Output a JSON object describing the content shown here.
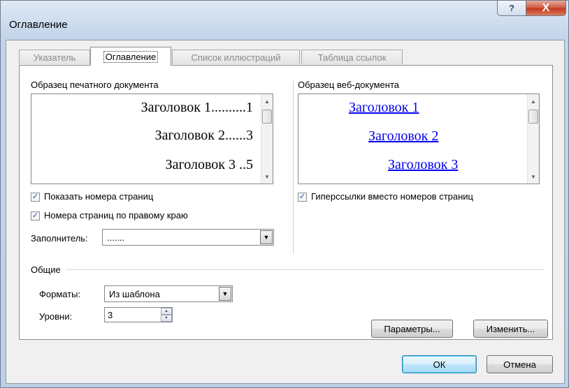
{
  "window": {
    "title": "Оглавление"
  },
  "titlebar": {
    "help_glyph": "?",
    "close_glyph": "X"
  },
  "tabs": [
    {
      "label": "Указатель",
      "active": false
    },
    {
      "label": "Оглавление",
      "active": true
    },
    {
      "label": "Список иллюстраций",
      "active": false
    },
    {
      "label": "Таблица ссылок",
      "active": false
    }
  ],
  "print_preview": {
    "label": "Образец печатного документа",
    "lines": [
      "Заголовок 1..........1",
      "Заголовок 2......3",
      "Заголовок 3 ..5"
    ]
  },
  "web_preview": {
    "label": "Образец веб-документа",
    "lines": [
      "Заголовок 1",
      "Заголовок 2",
      "Заголовок 3"
    ]
  },
  "options": {
    "show_page_numbers": {
      "label": "Показать номера страниц",
      "checked": true
    },
    "right_align": {
      "label": "Номера страниц по правому краю",
      "checked": true
    },
    "hyperlinks": {
      "label": "Гиперссылки вместо номеров страниц",
      "checked": true
    },
    "tab_leader": {
      "label": "Заполнитель:",
      "value": "......."
    }
  },
  "general": {
    "group_label": "Общие",
    "formats": {
      "label": "Форматы:",
      "value": "Из шаблона"
    },
    "levels": {
      "label": "Уровни:",
      "value": "3"
    }
  },
  "buttons": {
    "options": "Параметры...",
    "modify": "Изменить...",
    "ok": "ОК",
    "cancel": "Отмена"
  },
  "colors": {
    "hyperlink": "#0000ee",
    "close_button": "#c23a22",
    "window_frame": "#c2d4ea"
  }
}
